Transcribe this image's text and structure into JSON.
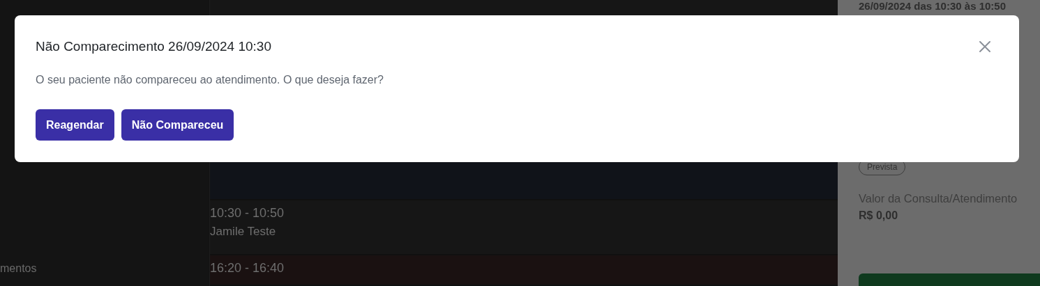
{
  "sidebar": {
    "label": "mentos"
  },
  "events": [
    {
      "color": "#101319"
    },
    {
      "time": "10:30 - 10:50",
      "patient": "Jamile Teste",
      "color": "#161616"
    },
    {
      "time": "16:20 - 16:40",
      "color": "#1a1111"
    }
  ],
  "detail_panel": {
    "schedule": "26/09/2024 das 10:30 às 10:50",
    "status": "Prevista",
    "price_label": "Valor da Consulta/Atendimento",
    "price": "R$ 0,00"
  },
  "modal": {
    "title": "Não Comparecimento 26/09/2024 10:30",
    "message": "O seu paciente não compareceu ao atendimento. O que deseja fazer?",
    "buttons": [
      {
        "label": "Reagendar"
      },
      {
        "label": "Não Compareceu"
      }
    ]
  }
}
